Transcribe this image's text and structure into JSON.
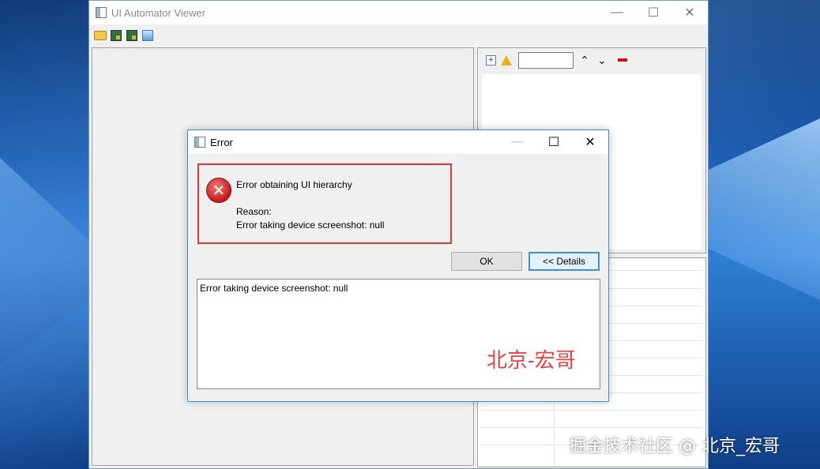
{
  "main_window": {
    "title": "UI Automator Viewer",
    "controls": {
      "minimize": "—",
      "maximize": "☐",
      "close": "✕"
    },
    "toolbar_icons": [
      "open-folder-icon",
      "device-screenshot-icon",
      "device-screenshot-compressed-icon",
      "save-icon"
    ]
  },
  "hierarchy_toolbar": {
    "filter_value": "",
    "up_arrow": "⌃",
    "down_arrow": "⌄",
    "expand_label": "+"
  },
  "dialog": {
    "title": "Error",
    "controls": {
      "minimize": "—",
      "maximize": "☐",
      "close": "✕"
    },
    "icon": "error-icon",
    "icon_glyph": "✕",
    "message_title": "Error obtaining UI hierarchy",
    "reason_label": "Reason:",
    "reason_text": "Error taking device screenshot: null",
    "ok_label": "OK",
    "details_label": "<< Details",
    "details_text": "Error taking device screenshot: null"
  },
  "watermarks": {
    "author": "北京-宏哥",
    "site": "掘金技术社区 @ 北京_宏哥"
  },
  "colors": {
    "highlight_border": "#e0383b",
    "dialog_border": "#3d8fd6",
    "watermark_red": "#e04545"
  }
}
